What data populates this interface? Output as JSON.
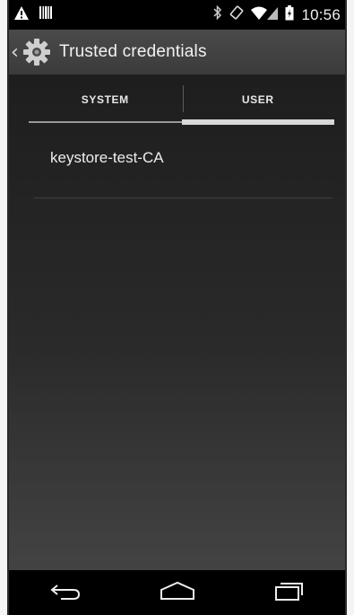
{
  "status_bar": {
    "time": "10:56",
    "icons": [
      "warning-icon",
      "barcode-icon",
      "bluetooth-icon",
      "rotate-icon",
      "wifi-icon",
      "signal-icon",
      "battery-icon"
    ]
  },
  "action_bar": {
    "title": "Trusted credentials",
    "icon": "settings-gear-icon"
  },
  "tabs": [
    {
      "label": "SYSTEM",
      "selected": false
    },
    {
      "label": "USER",
      "selected": true
    }
  ],
  "credentials": [
    {
      "name": "keystore-test-CA"
    }
  ],
  "nav_bar": {
    "buttons": [
      "back-icon",
      "home-icon",
      "recents-icon"
    ]
  },
  "colors": {
    "status_bar": "#000000",
    "action_bar": "#424242",
    "content_top": "#1e1e1e",
    "content_bottom": "#434343",
    "selected_indicator": "#d8d8d8"
  }
}
